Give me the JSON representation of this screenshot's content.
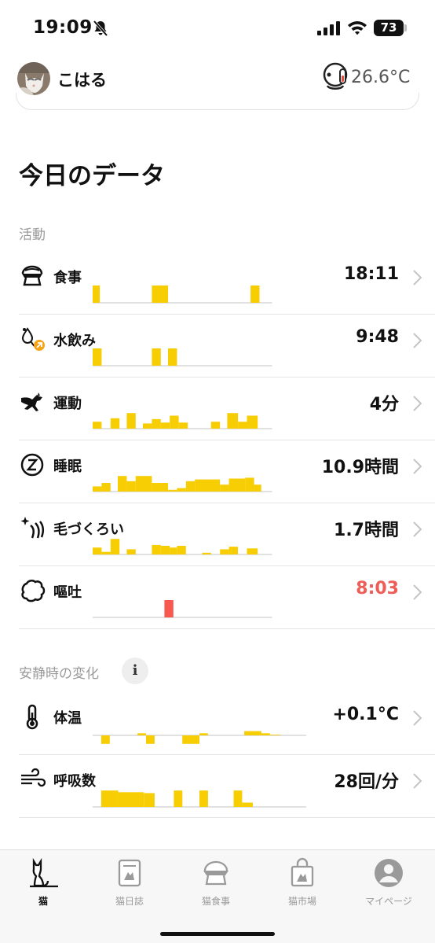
{
  "status_bar": {
    "time": "19:09",
    "battery": "73"
  },
  "header": {
    "cat_name": "こはる",
    "temperature": "26.6°C"
  },
  "section_title": "今日のデータ",
  "activity": {
    "label": "活動",
    "rows": [
      {
        "label": "食事",
        "value": "18:11",
        "icon": "food-bowl-icon",
        "bars": [
          [
            0,
            0.04,
            1
          ],
          [
            0.33,
            0.42,
            1
          ],
          [
            0.88,
            0.93,
            1
          ]
        ]
      },
      {
        "label": "水飲み",
        "value": "9:48",
        "icon": "water-drop-icon",
        "bars": [
          [
            0,
            0.05,
            1
          ],
          [
            0.33,
            0.38,
            1
          ],
          [
            0.42,
            0.47,
            1
          ]
        ]
      },
      {
        "label": "運動",
        "value": "4分",
        "icon": "running-cat-icon",
        "bars": [
          [
            0,
            0.05,
            0.4
          ],
          [
            0.1,
            0.15,
            0.6
          ],
          [
            0.19,
            0.24,
            0.9
          ],
          [
            0.28,
            0.33,
            0.3
          ],
          [
            0.33,
            0.38,
            0.55
          ],
          [
            0.38,
            0.43,
            0.35
          ],
          [
            0.43,
            0.48,
            0.75
          ],
          [
            0.48,
            0.53,
            0.35
          ],
          [
            0.66,
            0.71,
            0.4
          ],
          [
            0.75,
            0.81,
            0.9
          ],
          [
            0.81,
            0.86,
            0.4
          ],
          [
            0.86,
            0.92,
            0.75
          ]
        ]
      },
      {
        "label": "睡眠",
        "value": "10.9時間",
        "icon": "sleep-icon",
        "bars": [
          [
            0,
            0.05,
            0.3
          ],
          [
            0.05,
            0.1,
            0.5
          ],
          [
            0.14,
            0.19,
            0.9
          ],
          [
            0.19,
            0.24,
            0.6
          ],
          [
            0.24,
            0.33,
            0.9
          ],
          [
            0.33,
            0.42,
            0.5
          ],
          [
            0.42,
            0.47,
            0.1
          ],
          [
            0.47,
            0.52,
            0.2
          ],
          [
            0.52,
            0.57,
            0.6
          ],
          [
            0.57,
            0.71,
            0.7
          ],
          [
            0.71,
            0.76,
            0.4
          ],
          [
            0.76,
            0.85,
            0.75
          ],
          [
            0.85,
            0.9,
            0.8
          ],
          [
            0.9,
            0.94,
            0.4
          ]
        ]
      },
      {
        "label": "毛づくろい",
        "value": "1.7時間",
        "icon": "grooming-icon",
        "bars": [
          [
            0,
            0.05,
            0.4
          ],
          [
            0.05,
            0.1,
            0.15
          ],
          [
            0.1,
            0.15,
            0.9
          ],
          [
            0.19,
            0.24,
            0.3
          ],
          [
            0.33,
            0.38,
            0.55
          ],
          [
            0.38,
            0.43,
            0.5
          ],
          [
            0.43,
            0.47,
            0.4
          ],
          [
            0.47,
            0.52,
            0.5
          ],
          [
            0.61,
            0.66,
            0.1
          ],
          [
            0.71,
            0.76,
            0.3
          ],
          [
            0.76,
            0.81,
            0.45
          ],
          [
            0.86,
            0.92,
            0.35
          ]
        ]
      },
      {
        "label": "嘔吐",
        "value": "8:03",
        "icon": "vomit-icon",
        "alert": true,
        "bars": [
          [
            0.4,
            0.45,
            1
          ]
        ],
        "bar_color": "#f7584f"
      }
    ]
  },
  "resting": {
    "label": "安静時の変化",
    "info": "i",
    "rows": [
      {
        "label": "体温",
        "value": "+0.1°C",
        "icon": "thermometer-icon",
        "mode": "diverging",
        "bars": [
          [
            0.04,
            0.08,
            -0.6
          ],
          [
            0.21,
            0.25,
            0.15
          ],
          [
            0.25,
            0.29,
            -0.6
          ],
          [
            0.42,
            0.5,
            -0.6
          ],
          [
            0.5,
            0.54,
            0.15
          ],
          [
            0.71,
            0.79,
            0.3
          ],
          [
            0.79,
            0.83,
            0.15
          ],
          [
            0.83,
            0.88,
            0.05
          ]
        ]
      },
      {
        "label": "呼吸数",
        "value": "28回/分",
        "icon": "breath-icon",
        "mode": "resp",
        "bars": [
          [
            0.04,
            0.12,
            0.95
          ],
          [
            0.12,
            0.24,
            0.85
          ],
          [
            0.24,
            0.29,
            0.8
          ],
          [
            0.38,
            0.42,
            0.95
          ],
          [
            0.5,
            0.54,
            0.95
          ],
          [
            0.66,
            0.7,
            0.95
          ],
          [
            0.7,
            0.75,
            0.25
          ]
        ]
      }
    ]
  },
  "tabs": [
    {
      "label": "猫",
      "icon": "cat-icon",
      "active": true
    },
    {
      "label": "猫日誌",
      "icon": "diary-icon"
    },
    {
      "label": "猫食事",
      "icon": "bowl-icon"
    },
    {
      "label": "猫市場",
      "icon": "shopping-bag-icon"
    },
    {
      "label": "マイページ",
      "icon": "profile-icon"
    }
  ],
  "colors": {
    "accent": "#f7cd04",
    "alert": "#ee5d56",
    "badge_orange": "#f5a417"
  }
}
